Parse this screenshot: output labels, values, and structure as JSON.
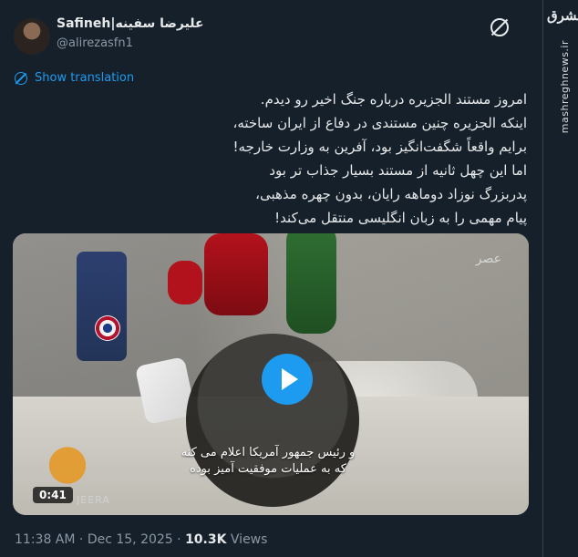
{
  "author": {
    "display_name": "Safineh|علیرضا سفینه",
    "handle": "@alirezasfn1"
  },
  "actions": {
    "translate_label": "Show translation"
  },
  "tweet": {
    "lines": [
      "امروز مستند الجزیره درباره جنگ اخیر رو دیدم.",
      "اینکه الجزیره چنین مستندی در دفاع از ایران ساخته،",
      "برایم واقعاً شگفت‌انگیز بود، آفرین به وزارت خارجه!",
      "اما این چهل ثانیه از مستند بسیار جذاب تر بود",
      "پدربزرگ نوزاد دوماهه رایان، بدون چهره مذهبی،",
      "پیام مهمی را به زبان انگلیسی منتقل می‌کند!"
    ]
  },
  "media": {
    "duration": "0:41",
    "channel_logo_text": "عصر",
    "subtitle_lines": [
      "و رئیس جمهور آمریکا اعلام می کنه",
      "که به عملیات موفقیت آمیز بوده"
    ],
    "watermark_text": "JEERA"
  },
  "meta": {
    "time": "11:38 AM",
    "separator": "·",
    "date": "Dec 15, 2025",
    "views_count": "10.3K",
    "views_label": "Views"
  },
  "brand": {
    "logo_text": "مشرق",
    "site": "mashreghnews.ir"
  },
  "colors": {
    "background": "#15202b",
    "accent": "#1d9bf0",
    "muted": "#8b98a5",
    "text": "#e7e9ea"
  }
}
